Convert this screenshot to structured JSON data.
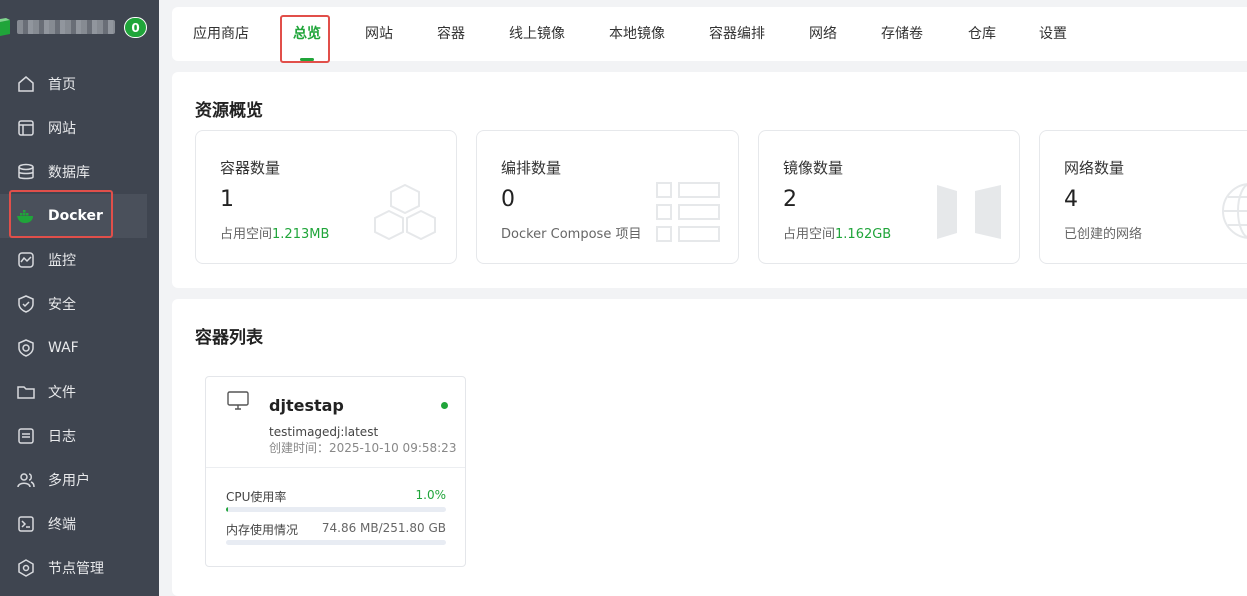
{
  "sidebar": {
    "badge_count": "0",
    "items": [
      {
        "label": "首页",
        "icon": "home-icon"
      },
      {
        "label": "网站",
        "icon": "website-icon"
      },
      {
        "label": "数据库",
        "icon": "database-icon"
      },
      {
        "label": "Docker",
        "icon": "docker-icon"
      },
      {
        "label": "监控",
        "icon": "monitor-icon"
      },
      {
        "label": "安全",
        "icon": "shield-icon"
      },
      {
        "label": "WAF",
        "icon": "waf-icon"
      },
      {
        "label": "文件",
        "icon": "folder-icon"
      },
      {
        "label": "日志",
        "icon": "log-icon"
      },
      {
        "label": "多用户",
        "icon": "users-icon"
      },
      {
        "label": "终端",
        "icon": "terminal-icon"
      },
      {
        "label": "节点管理",
        "icon": "nodes-icon"
      }
    ],
    "active": "Docker"
  },
  "tabs": [
    {
      "label": "应用商店"
    },
    {
      "label": "总览"
    },
    {
      "label": "网站"
    },
    {
      "label": "容器"
    },
    {
      "label": "线上镜像"
    },
    {
      "label": "本地镜像"
    },
    {
      "label": "容器编排"
    },
    {
      "label": "网络"
    },
    {
      "label": "存储卷"
    },
    {
      "label": "仓库"
    },
    {
      "label": "设置"
    }
  ],
  "active_tab": "总览",
  "overview": {
    "title": "资源概览",
    "cards": [
      {
        "label": "容器数量",
        "value": "1",
        "sub_prefix": "占用空间",
        "sub_value": "1.213MB"
      },
      {
        "label": "编排数量",
        "value": "0",
        "sub_prefix": "Docker Compose 项目",
        "sub_value": ""
      },
      {
        "label": "镜像数量",
        "value": "2",
        "sub_prefix": "占用空间",
        "sub_value": "1.162GB"
      },
      {
        "label": "网络数量",
        "value": "4",
        "sub_prefix": "已创建的网络",
        "sub_value": ""
      }
    ]
  },
  "containers": {
    "title": "容器列表",
    "items": [
      {
        "name": "djtestap",
        "image": "testimagedj:latest",
        "created": "创建时间：2025-10-10 09:58:23",
        "cpu_label": "CPU使用率",
        "cpu_value": "1.0%",
        "cpu_fraction": 0.01,
        "mem_label": "内存使用情况",
        "mem_value": "74.86 MB/251.80 GB",
        "mem_fraction": 0.0003
      }
    ]
  },
  "colors": {
    "accent": "#20a53a",
    "sidebar_bg": "#3f4550",
    "highlight_box": "#e14f4a"
  }
}
